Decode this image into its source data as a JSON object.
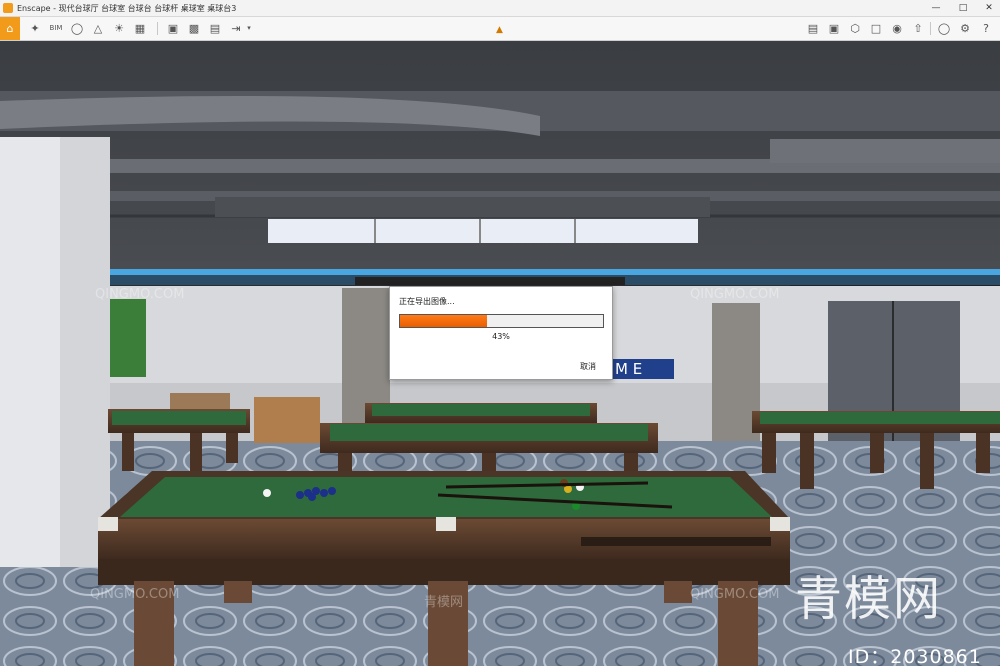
{
  "window": {
    "title": "Enscape - 现代台球厅 台球室 台球台 台球杆 桌球室 桌球台3"
  },
  "toolbar": {
    "left_icons": [
      "home-icon",
      "pointer-icon",
      "bim-icon",
      "binoculars-icon",
      "walk-icon",
      "sun-icon",
      "buildings-icon",
      "atmosphere-icon",
      "capture-icon",
      "render-icon",
      "export-icon",
      "export-dropdown-icon"
    ],
    "right_icons": [
      "book-icon",
      "screen-icon",
      "cube-icon",
      "map-icon",
      "palette-icon",
      "upload-icon",
      "eye-icon",
      "settings-icon",
      "help-icon"
    ]
  },
  "dialog": {
    "title": "正在导出图像...",
    "progress": 0.43,
    "percent": "43%",
    "cancel": "取消"
  },
  "watermarks": {
    "latin": "QINGMO.COM",
    "chinese": "青模网"
  },
  "brand": {
    "text": "青模网",
    "id": "ID：2030861"
  },
  "colors": {
    "accent": "#f29a1a",
    "progress": "#f26b0c",
    "felt": "#2f6a3c"
  }
}
